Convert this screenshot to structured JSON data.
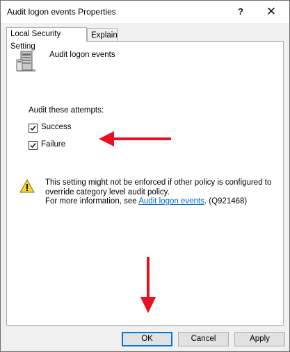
{
  "window": {
    "title": "Audit logon events Properties",
    "help_label": "?",
    "close_label": "✕"
  },
  "tabs": [
    {
      "label": "Local Security Setting"
    },
    {
      "label": "Explain"
    }
  ],
  "policy": {
    "name": "Audit logon events"
  },
  "audit": {
    "heading": "Audit these attempts:",
    "options": [
      {
        "label": "Success",
        "checked": true
      },
      {
        "label": "Failure",
        "checked": true
      }
    ]
  },
  "warning": {
    "line1": "This setting might not be enforced if other policy is configured to",
    "line2": "override category level audit policy.",
    "line3_prefix": "For more information, see ",
    "link_text": "Audit logon events",
    "line3_suffix": ". (Q921468)"
  },
  "buttons": {
    "ok": "OK",
    "cancel": "Cancel",
    "apply": "Apply"
  },
  "colors": {
    "annotation_arrow": "#e81123",
    "link": "#0066cc",
    "accent": "#0078d7"
  }
}
